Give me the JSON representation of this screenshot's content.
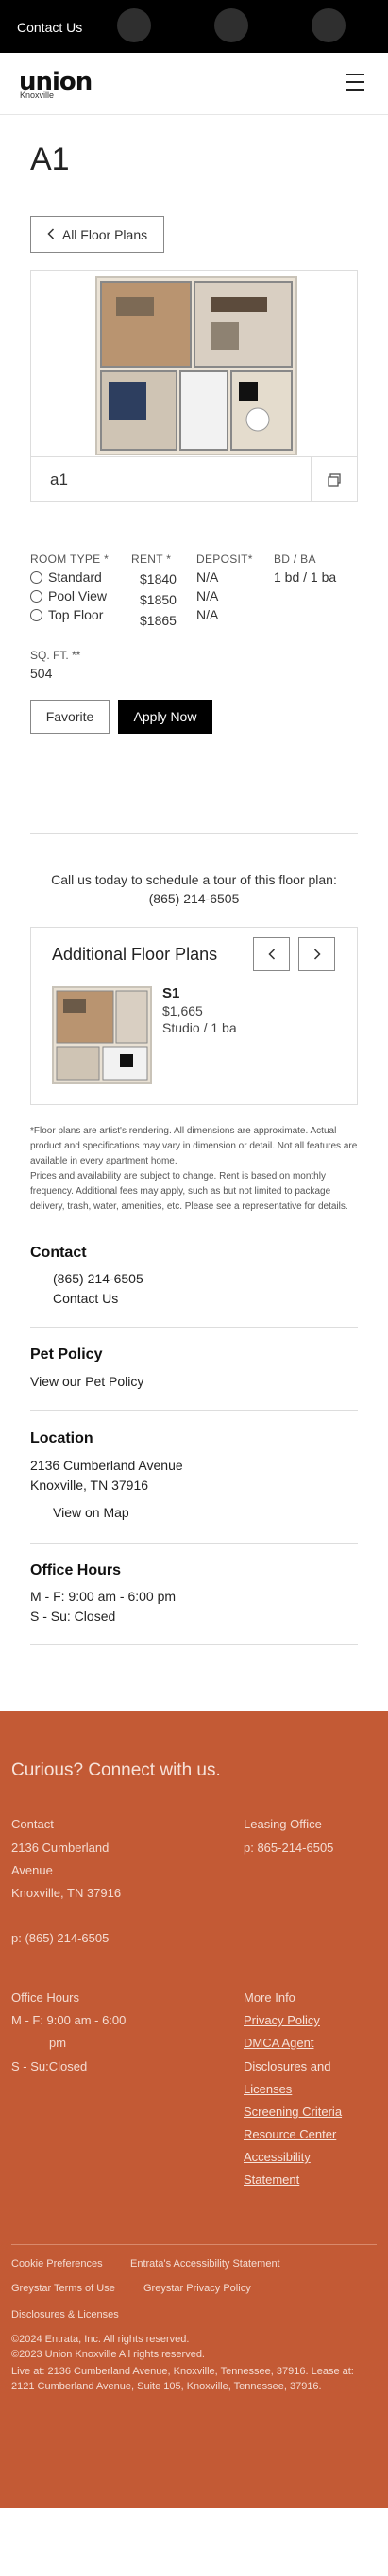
{
  "topbar": {
    "contact_label": "Contact Us"
  },
  "header": {
    "logo": "union",
    "logo_sub": "Knoxville",
    "menu_icon": "hamburger-icon"
  },
  "page": {
    "title": "A1",
    "all_plans_label": "All Floor Plans"
  },
  "plan": {
    "name": "a1",
    "copy_icon": "copy-icon"
  },
  "details": {
    "headers": [
      "ROOM TYPE *",
      "RENT *",
      "DEPOSIT*",
      "BD / BA"
    ],
    "rows": [
      {
        "type": "Standard",
        "rent": "$1840",
        "deposit": "N/A"
      },
      {
        "type": "Pool View",
        "rent": "$1850",
        "deposit": "N/A"
      },
      {
        "type": "Top Floor",
        "rent": "$1865",
        "deposit": "N/A"
      }
    ],
    "bdba": "1 bd / 1 ba",
    "sqft_label": "SQ. FT. **",
    "sqft_value": "504"
  },
  "actions": {
    "favorite": "Favorite",
    "apply": "Apply Now"
  },
  "call": {
    "text": "Call us today to schedule a tour of this floor plan:",
    "phone": "(865) 214-6505"
  },
  "additional": {
    "title": "Additional Floor Plans",
    "name": "S1",
    "price": "$1,665",
    "bedbath": "Studio / 1 ba"
  },
  "disclaimer": {
    "p1": "*Floor plans are artist's rendering. All dimensions are approximate. Actual product and specifications may vary in dimension or detail. Not all features are available in every apartment home.",
    "p2": "Prices and availability are subject to change. Rent is based on monthly frequency. Additional fees may apply, such as but not limited to package delivery, trash, water, amenities, etc. Please see a representative for details."
  },
  "contact": {
    "heading": "Contact",
    "phone": "(865) 214-6505",
    "link": "Contact Us"
  },
  "pet": {
    "heading": "Pet Policy",
    "link": "View our Pet Policy"
  },
  "location": {
    "heading": "Location",
    "line1": "2136 Cumberland Avenue",
    "line2": "Knoxville, TN 37916",
    "map": "View on Map"
  },
  "hours": {
    "heading": "Office Hours",
    "line1": "M - F:  9:00 am - 6:00 pm",
    "line2": "S - Su:  Closed"
  },
  "footer": {
    "heading": "Curious? Connect with us.",
    "contact_h": "Contact",
    "addr1": "2136 Cumberland",
    "addr2": "Avenue",
    "addr3": "Knoxville, TN 37916",
    "phone": "p: (865) 214-6505",
    "leasing_h": "Leasing Office",
    "leasing_phone": "p: 865-214-6505",
    "hours_h": "Office Hours",
    "hours1": "M - F: 9:00 am - 6:00",
    "hours1b": "pm",
    "hours2": "S - Su:Closed",
    "more_h": "More Info",
    "more_links": [
      "Privacy Policy",
      "DMCA Agent",
      "Disclosures and",
      "Licenses",
      "Screening Criteria",
      "Resource Center",
      "Accessibility",
      "Statement"
    ],
    "bottom_links": [
      "Cookie Preferences",
      "Entrata's Accessibility Statement",
      "Greystar Terms of Use",
      "Greystar Privacy Policy",
      "Disclosures & Licenses"
    ],
    "copy1": "©2024 Entrata, Inc. All rights reserved.",
    "copy2": "©2023 Union Knoxville All rights reserved.",
    "copy3": "Live at: 2136 Cumberland Avenue, Knoxville, Tennessee, 37916. Lease at: 2121 Cumberland Avenue, Suite 105, Knoxville, Tennessee, 37916."
  },
  "colors": {
    "footer_bg": "#c35a35",
    "apply_bg": "#000000"
  }
}
